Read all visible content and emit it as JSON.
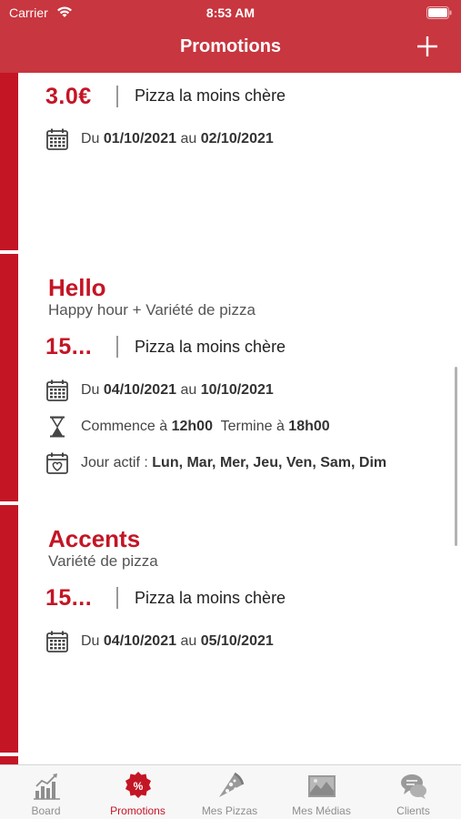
{
  "status_bar": {
    "carrier": "Carrier",
    "time": "8:53 AM"
  },
  "nav": {
    "title": "Promotions"
  },
  "promotions": [
    {
      "title": "",
      "subtitle": "",
      "price": "3.0€",
      "type": "Pizza la moins chère",
      "dates": {
        "prefix": "Du",
        "start": "01/10/2021",
        "middle": "au",
        "end": "02/10/2021"
      }
    },
    {
      "title": "Hello",
      "subtitle": "Happy hour + Variété de pizza",
      "price": "15...",
      "type": "Pizza la moins chère",
      "dates": {
        "prefix": "Du",
        "start": "04/10/2021",
        "middle": "au",
        "end": "10/10/2021"
      },
      "hours": {
        "start_label": "Commence à",
        "start": "12h00",
        "end_label": "Termine à",
        "end": "18h00"
      },
      "days": {
        "label": "Jour actif :",
        "value": "Lun, Mar, Mer, Jeu, Ven, Sam, Dim"
      }
    },
    {
      "title": "Accents",
      "subtitle": "Variété de pizza",
      "price": "15...",
      "type": "Pizza la moins chère",
      "dates": {
        "prefix": "Du",
        "start": "04/10/2021",
        "middle": "au",
        "end": "05/10/2021"
      }
    }
  ],
  "tabs": [
    {
      "label": "Board",
      "icon": "chart-icon"
    },
    {
      "label": "Promotions",
      "icon": "percent-badge-icon",
      "active": true
    },
    {
      "label": "Mes Pizzas",
      "icon": "pizza-icon"
    },
    {
      "label": "Mes Médias",
      "icon": "image-icon"
    },
    {
      "label": "Clients",
      "icon": "chat-bubbles-icon"
    }
  ],
  "colors": {
    "brand_red": "#c41525",
    "header_red": "#c8363f",
    "tab_inactive": "#8e8e8e"
  }
}
